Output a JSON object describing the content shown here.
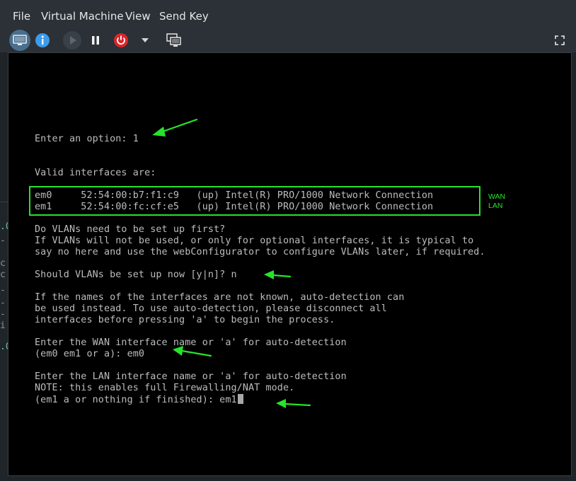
{
  "menubar": {
    "items": [
      "File",
      "Virtual Machine",
      "View",
      "Send Key"
    ]
  },
  "toolbar": {
    "buttons": [
      {
        "name": "monitor-icon",
        "active": true
      },
      {
        "name": "info-icon"
      },
      {
        "name": "play-icon",
        "disabled": true
      },
      {
        "name": "pause-icon"
      },
      {
        "name": "power-icon"
      },
      {
        "name": "chevron-down-icon"
      },
      {
        "name": "snapshot-icon"
      },
      {
        "name": "fullscreen-icon"
      }
    ]
  },
  "terminal": {
    "lines": [
      "Enter an option: 1",
      "Valid interfaces are:",
      "em0     52:54:00:b7:f1:c9   (up) Intel(R) PRO/1000 Network Connection",
      "em1     52:54:00:fc:cf:e5   (up) Intel(R) PRO/1000 Network Connection",
      "Do VLANs need to be set up first?",
      "If VLANs will not be used, or only for optional interfaces, it is typical to",
      "say no here and use the webConfigurator to configure VLANs later, if required.",
      "Should VLANs be set up now [y|n]? n",
      "If the names of the interfaces are not known, auto-detection can",
      "be used instead. To use auto-detection, please disconnect all",
      "interfaces before pressing 'a' to begin the process.",
      "Enter the WAN interface name or 'a' for auto-detection",
      "(em0 em1 or a): em0",
      "Enter the LAN interface name or 'a' for auto-detection",
      "NOTE: this enables full Firewalling/NAT mode.",
      "(em1 a or nothing if finished): em1"
    ]
  },
  "annotations": {
    "wan_label": "WAN",
    "lan_label": "LAN",
    "highlight_color": "#27e32a",
    "arrow_color": "#27e32a"
  },
  "colors": {
    "menubar_bg": "#2b3137",
    "terminal_bg": "#000000",
    "terminal_fg": "#bdbdbd",
    "power_red": "#d9262c",
    "info_blue": "#3d9be9"
  }
}
